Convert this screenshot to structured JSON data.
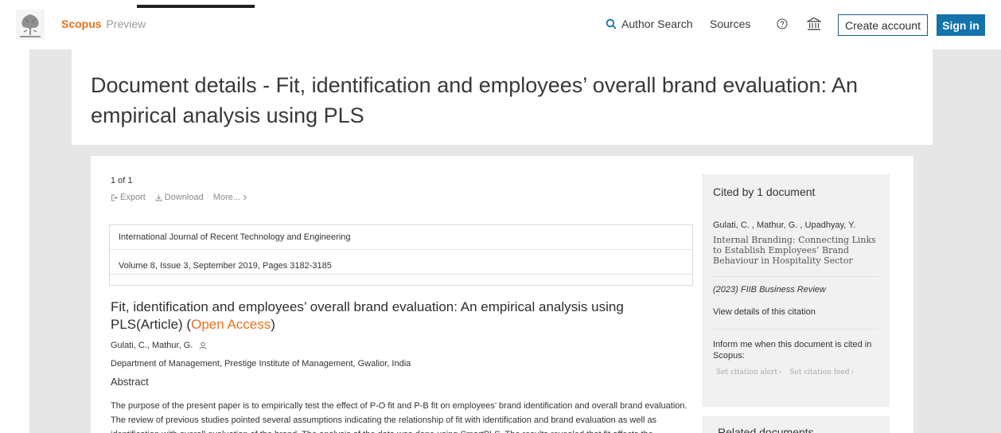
{
  "nav": {
    "brand_name": "Scopus",
    "brand_sub": "Preview",
    "author_search": "Author Search",
    "sources": "Sources",
    "create_account": "Create account",
    "sign_in": "Sign in",
    "icons": [
      "elsevier-logo",
      "search-icon",
      "help-icon",
      "institution-icon"
    ]
  },
  "page": {
    "title": "Document details - Fit, identification and employees’ overall brand evaluation: An empirical analysis using PLS"
  },
  "main": {
    "pager": "1 of 1",
    "export": "Export",
    "download": "Download",
    "more": "More...",
    "source_journal": "International Journal of Recent Technology and Engineering",
    "source_volume": "Volume 8, Issue 3, September 2019, Pages 3182-3185",
    "article_title": "Fit, identification and employees’ overall brand evaluation: An empirical analysis using PLS(Article)",
    "open_access_open": "(",
    "open_access_label": "Open Access",
    "open_access_close": ")",
    "authors": "Gulati, C.,   Mathur, G.",
    "affiliation": "Department of Management, Prestige Institute of Management, Gwalior, India",
    "abstract_heading": "Abstract",
    "abstract_text": "The purpose of the present paper is to empirically test the effect of P-O fit and P-B fit on employees’ brand identification and overall brand evaluation. The review of previous studies pointed several assumptions indicating the relationship of fit with identification and brand evaluation as well as identification with overall evaluation of the brand. The analysis of the data was done using SmartPLS. The results revealed that fit affects the"
  },
  "sidebar": {
    "cited_title": "Cited by 1 document",
    "cited_authors": "Gulati, C. , Mathur, G. , Upadhyay, Y.",
    "cited_doc_title": "Internal Branding: Connecting Links to Establish Employees’ Brand Behaviour in Hospitality Sector",
    "cited_journal": "(2023) FIIB Business Review",
    "view_details": "View details of this citation",
    "inform": "Inform me when this document is cited in Scopus:",
    "set_alert": "Set citation alert",
    "set_feed": "Set citation feed",
    "related_title": "Related documents"
  },
  "colors": {
    "accent_orange": "#e9711c",
    "signin_blue": "#1373ab",
    "band_grey": "#e6e6e6",
    "panel_grey": "#f1f1f1"
  }
}
